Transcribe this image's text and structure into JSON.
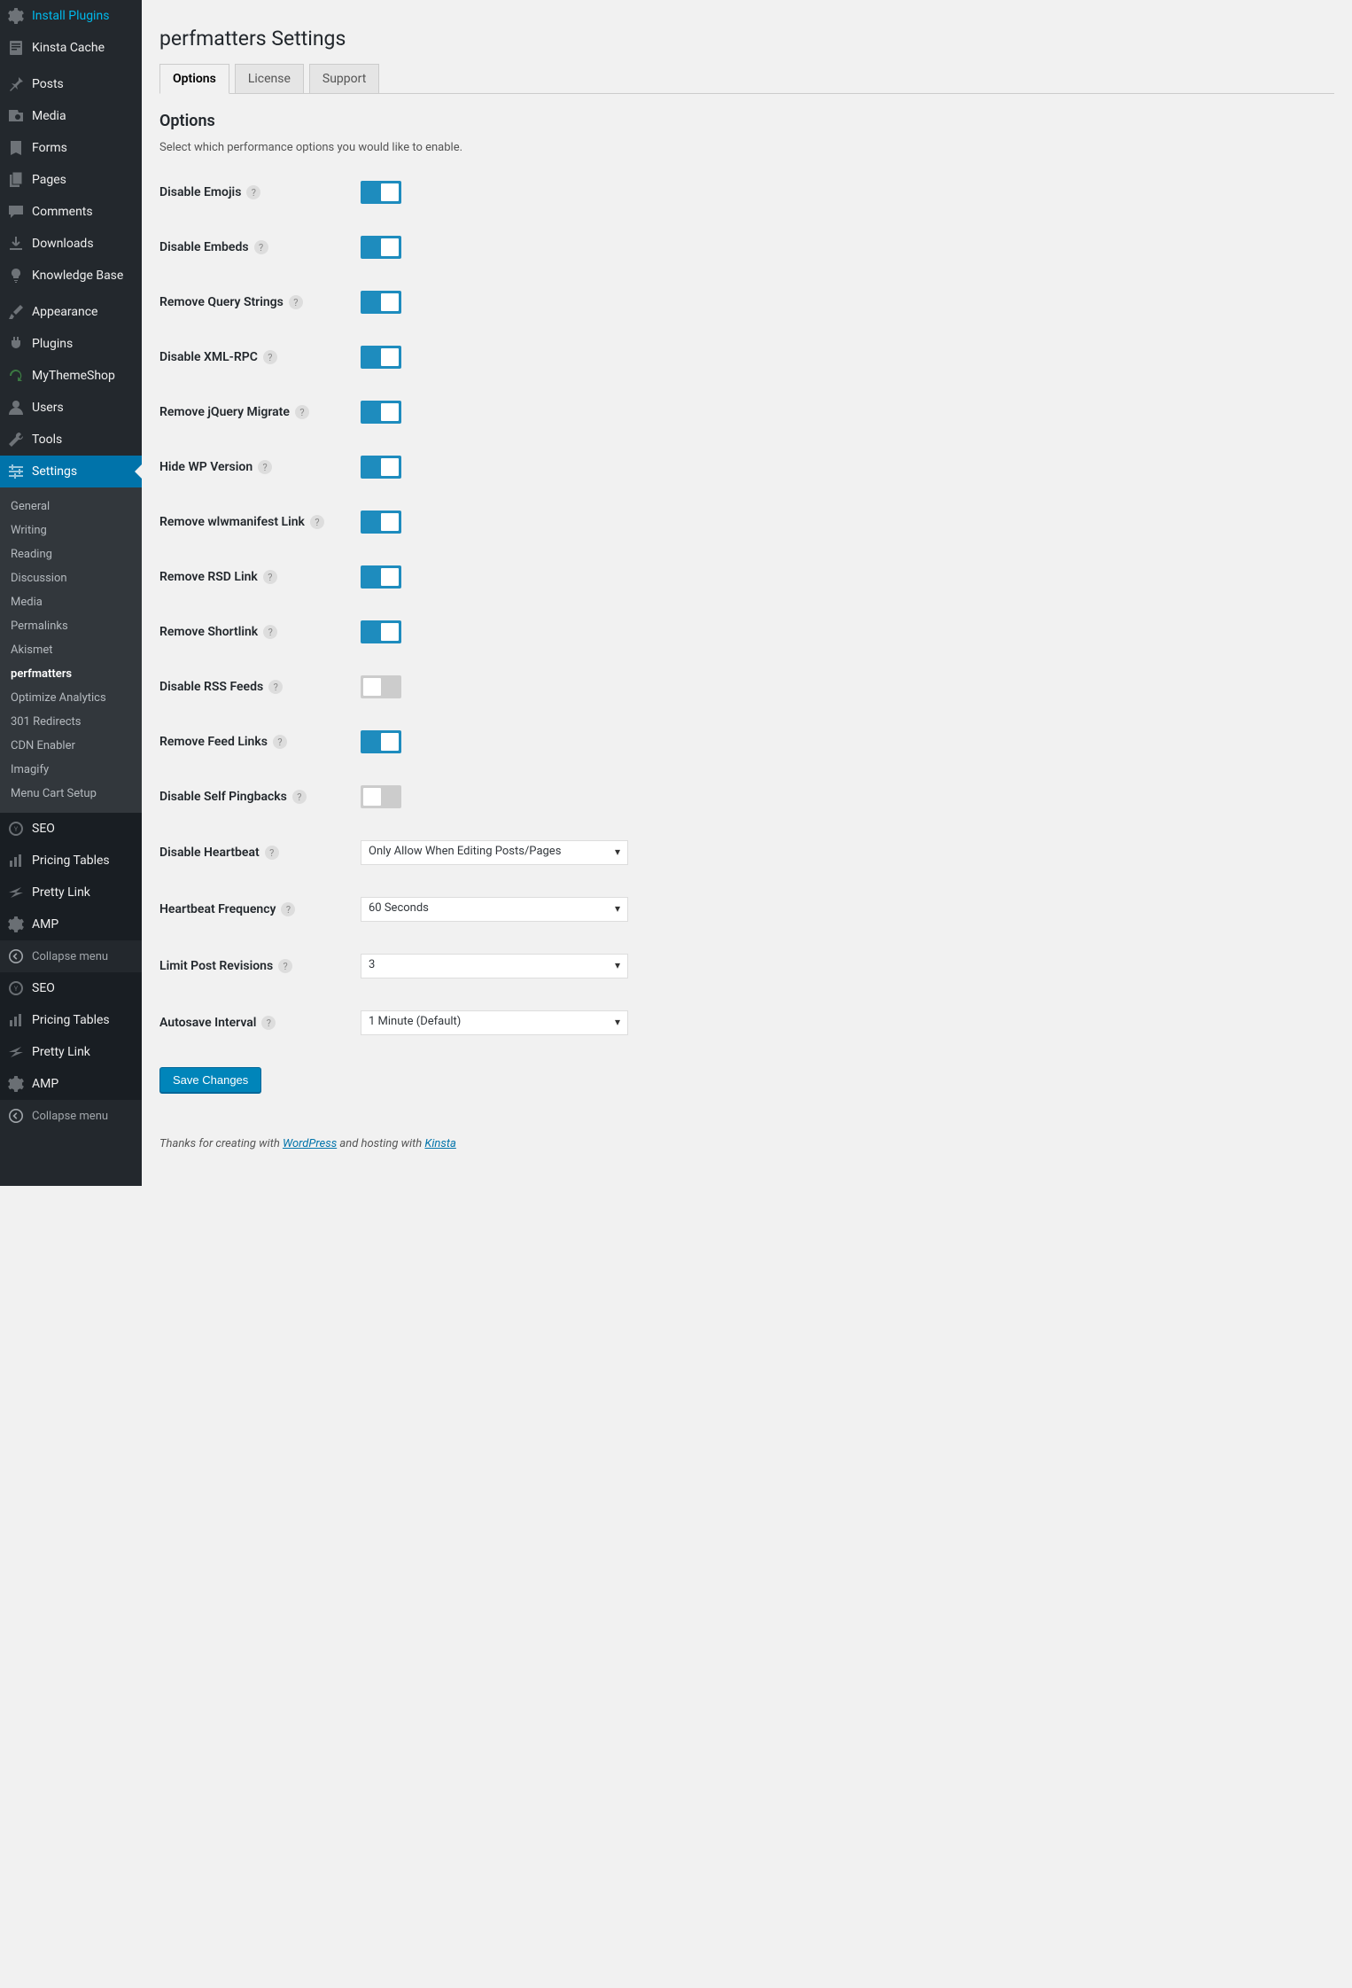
{
  "sidebar": {
    "items": [
      {
        "label": "Install Plugins",
        "icon": "gear"
      },
      {
        "label": "Kinsta Cache",
        "icon": "page"
      },
      {
        "label": "Posts",
        "icon": "pin"
      },
      {
        "label": "Media",
        "icon": "media"
      },
      {
        "label": "Forms",
        "icon": "forms"
      },
      {
        "label": "Pages",
        "icon": "pages"
      },
      {
        "label": "Comments",
        "icon": "comment"
      },
      {
        "label": "Downloads",
        "icon": "download"
      },
      {
        "label": "Knowledge Base",
        "icon": "bulb"
      },
      {
        "label": "Appearance",
        "icon": "brush"
      },
      {
        "label": "Plugins",
        "icon": "plug"
      },
      {
        "label": "MyThemeShop",
        "icon": "refresh"
      },
      {
        "label": "Users",
        "icon": "user"
      },
      {
        "label": "Tools",
        "icon": "wrench"
      },
      {
        "label": "Settings",
        "icon": "sliders"
      }
    ],
    "sub": [
      "General",
      "Writing",
      "Reading",
      "Discussion",
      "Media",
      "Permalinks",
      "Akismet",
      "perfmatters",
      "Optimize Analytics",
      "301 Redirects",
      "CDN Enabler",
      "Imagify",
      "Menu Cart Setup"
    ],
    "sub_active": "perfmatters",
    "bottom1": [
      {
        "label": "SEO",
        "icon": "seo"
      },
      {
        "label": "Pricing Tables",
        "icon": "bars"
      },
      {
        "label": "Pretty Link",
        "icon": "star"
      },
      {
        "label": "AMP",
        "icon": "gear"
      }
    ],
    "collapse": "Collapse menu",
    "bottom2": [
      {
        "label": "SEO",
        "icon": "seo"
      },
      {
        "label": "Pricing Tables",
        "icon": "bars"
      },
      {
        "label": "Pretty Link",
        "icon": "star"
      },
      {
        "label": "AMP",
        "icon": "gear"
      }
    ]
  },
  "page": {
    "title": "perfmatters Settings",
    "tabs": [
      "Options",
      "License",
      "Support"
    ],
    "active_tab": "Options",
    "section_title": "Options",
    "section_desc": "Select which performance options you would like to enable.",
    "settings": [
      {
        "label": "Disable Emojis",
        "type": "toggle",
        "value": true
      },
      {
        "label": "Disable Embeds",
        "type": "toggle",
        "value": true
      },
      {
        "label": "Remove Query Strings",
        "type": "toggle",
        "value": true
      },
      {
        "label": "Disable XML-RPC",
        "type": "toggle",
        "value": true
      },
      {
        "label": "Remove jQuery Migrate",
        "type": "toggle",
        "value": true
      },
      {
        "label": "Hide WP Version",
        "type": "toggle",
        "value": true
      },
      {
        "label": "Remove wlwmanifest Link",
        "type": "toggle",
        "value": true
      },
      {
        "label": "Remove RSD Link",
        "type": "toggle",
        "value": true
      },
      {
        "label": "Remove Shortlink",
        "type": "toggle",
        "value": true
      },
      {
        "label": "Disable RSS Feeds",
        "type": "toggle",
        "value": false
      },
      {
        "label": "Remove Feed Links",
        "type": "toggle",
        "value": true
      },
      {
        "label": "Disable Self Pingbacks",
        "type": "toggle",
        "value": false
      },
      {
        "label": "Disable Heartbeat",
        "type": "select",
        "value": "Only Allow When Editing Posts/Pages"
      },
      {
        "label": "Heartbeat Frequency",
        "type": "select",
        "value": "60 Seconds"
      },
      {
        "label": "Limit Post Revisions",
        "type": "select",
        "value": "3"
      },
      {
        "label": "Autosave Interval",
        "type": "select",
        "value": "1 Minute (Default)"
      }
    ],
    "save": "Save Changes",
    "footer": {
      "pre": "Thanks for creating with ",
      "link1": "WordPress",
      "mid": " and hosting with ",
      "link2": "Kinsta"
    }
  }
}
